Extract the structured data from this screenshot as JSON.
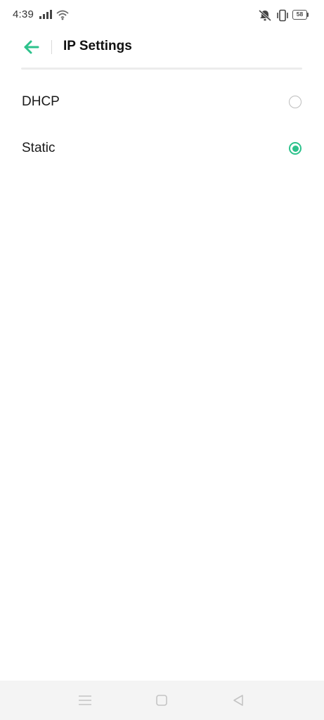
{
  "status_bar": {
    "time": "4:39",
    "battery_level": "58",
    "icons": [
      "signal-icon",
      "wifi-icon",
      "mute-icon",
      "vibrate-icon",
      "battery-icon"
    ]
  },
  "header": {
    "title": "IP Settings",
    "back_icon": "back-arrow-icon"
  },
  "options": [
    {
      "label": "DHCP",
      "selected": false
    },
    {
      "label": "Static",
      "selected": true
    }
  ],
  "nav_bar": {
    "icons": [
      "menu-icon",
      "home-icon",
      "back-icon"
    ]
  },
  "colors": {
    "accent": "#2dc28c",
    "radio_unchecked": "#bdbdbd",
    "nav_background": "#f4f4f4"
  }
}
